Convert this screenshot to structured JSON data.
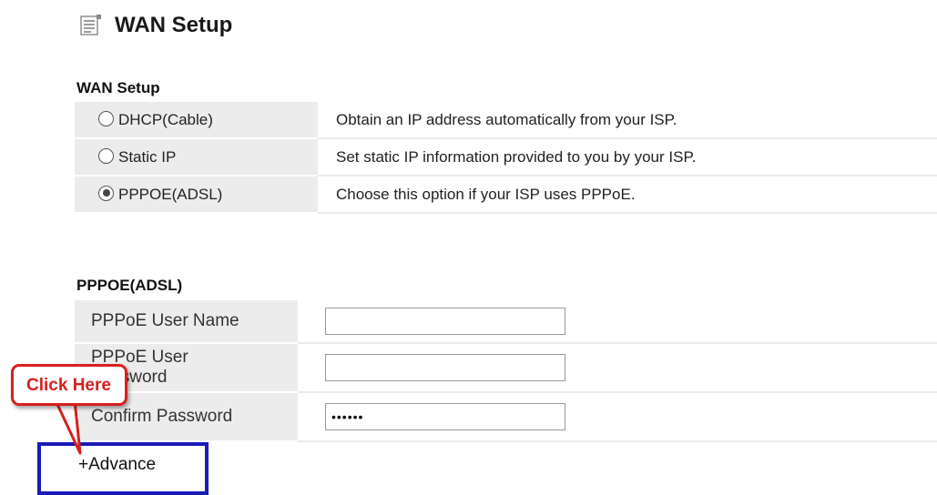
{
  "page": {
    "title": "WAN Setup"
  },
  "wan_section": {
    "title": "WAN Setup",
    "options": [
      {
        "label": "DHCP(Cable)",
        "description": "Obtain an IP address automatically from your ISP.",
        "selected": false
      },
      {
        "label": "Static IP",
        "description": "Set static IP information provided to you by your ISP.",
        "selected": false
      },
      {
        "label": "PPPOE(ADSL)",
        "description": "Choose this option if your ISP uses PPPoE.",
        "selected": true
      }
    ]
  },
  "pppoe_section": {
    "title": "PPPOE(ADSL)",
    "user_name": {
      "label": "PPPoE User Name",
      "value": ""
    },
    "password": {
      "label_line1": "PPPoE User",
      "label_line2": "Password",
      "value": ""
    },
    "confirm_password": {
      "label": "Confirm Password",
      "value": "••••••"
    }
  },
  "advance_link": {
    "label": "+Advance"
  },
  "callout": {
    "text": "Click Here",
    "color": "#d8201e",
    "box_color": "#1a1ab8"
  }
}
